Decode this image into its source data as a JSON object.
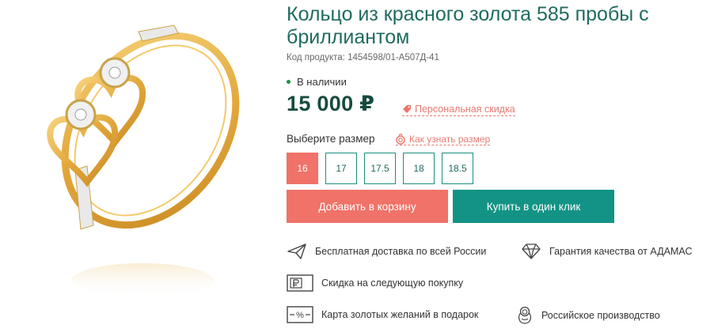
{
  "product": {
    "title": "Кольцо из красного золота 585 пробы с бриллиантом",
    "sku_label": "Код продукта:",
    "sku_value": "1454598/01-А507Д-41",
    "stock": "В наличии",
    "price": "15 000 ₽",
    "discount_link": "Персональная скидка"
  },
  "size_picker": {
    "label": "Выберите размер",
    "help_link": "Как узнать размер",
    "options": [
      "16",
      "17",
      "17.5",
      "18",
      "18.5"
    ],
    "selected": "16"
  },
  "actions": {
    "add_to_cart": "Добавить в корзину",
    "buy_one_click": "Купить в один клик"
  },
  "features": [
    {
      "icon": "paper-plane-icon",
      "text": "Бесплатная доставка по всей России"
    },
    {
      "icon": "diamond-icon",
      "text": "Гарантия качества от АДАМАС"
    },
    {
      "icon": "ruble-card-icon",
      "text": "Скидка на следующую покупку"
    },
    {
      "icon": "percent-card-icon",
      "text": "Карта золотых желаний в подарок"
    },
    {
      "icon": "matryoshka-icon",
      "text": "Российское производство"
    }
  ],
  "colors": {
    "title": "#1f6b60",
    "price": "#174b3f",
    "accent_coral": "#f07268",
    "accent_teal": "#139386",
    "in_stock_dot": "#1e8f3d"
  }
}
